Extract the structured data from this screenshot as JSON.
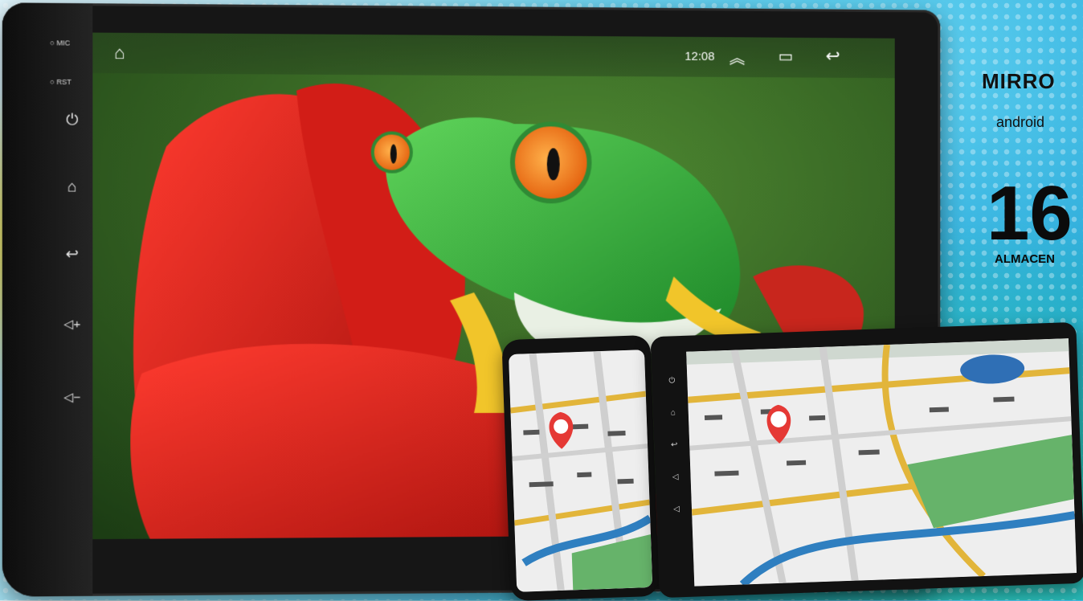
{
  "promo": {
    "title": "MIRRO",
    "subtitle": "android",
    "storage_number": "16",
    "storage_label": "ALMACEN"
  },
  "head_unit": {
    "side_labels": {
      "mic": "MIC",
      "rst": "RST"
    },
    "side_buttons": [
      "power-icon",
      "home-icon",
      "back-icon",
      "volume-up-icon",
      "volume-down-icon"
    ],
    "statusbar": {
      "time": "12:08"
    }
  },
  "colors": {
    "bezel": "#161616",
    "frog_green": "#39b24a",
    "flower_red": "#d8211c",
    "map_road": "#e2b53a",
    "map_pin": "#e53935"
  }
}
